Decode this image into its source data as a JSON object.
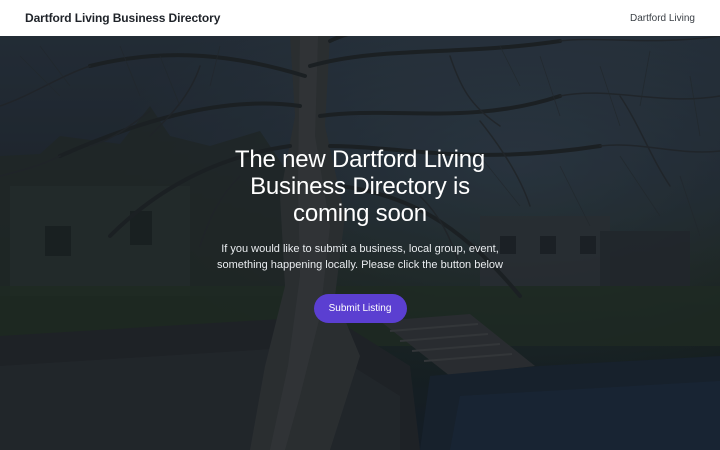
{
  "header": {
    "brand": "Dartford Living Business Directory",
    "nav_link": "Dartford Living"
  },
  "hero": {
    "title": "The new Dartford Living Business Directory is coming soon",
    "text": "If you would like to submit a business, local group, event, something happening locally. Please click the button below",
    "button_label": "Submit Listing"
  },
  "colors": {
    "header_bg": "#ffffff",
    "button_bg": "#5b3fd1",
    "hero_text": "#ffffff"
  }
}
